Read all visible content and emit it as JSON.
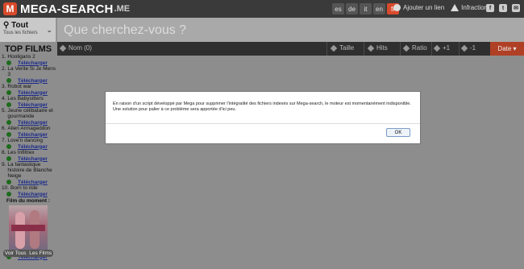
{
  "header": {
    "logo_letter": "M",
    "logo_text": "MEGA-SEARCH",
    "logo_ext": ".ME",
    "languages": [
      "es",
      "de",
      "it",
      "en",
      "fr"
    ],
    "active_language": "fr",
    "add_link_label": "Ajouter un lien",
    "infraction_label": "Infraction",
    "social": [
      "f",
      "t",
      "✉"
    ]
  },
  "search": {
    "category_label": "Tout",
    "category_sub": "Tous les fichiers",
    "placeholder": "Que cherchez-vous ?"
  },
  "columns": {
    "name": "Nom (0)",
    "size": "Taille",
    "hits": "Hits",
    "ratio": "Ratio",
    "plus": "+1",
    "minus": "-1",
    "date": "Date"
  },
  "sidebar": {
    "title": "TOP FILMS",
    "download_label": "Télécharger",
    "films": [
      {
        "num": "1.",
        "title": "Hooligans 2"
      },
      {
        "num": "2.",
        "title": "La Verite Si Je Mens 3"
      },
      {
        "num": "3.",
        "title": "Robot war"
      },
      {
        "num": "4.",
        "title": "Les Babysitters"
      },
      {
        "num": "5.",
        "title": "Jeune célibataire et gourmande"
      },
      {
        "num": "6.",
        "title": "Alien Armageddon"
      },
      {
        "num": "7.",
        "title": "Love'n dancing"
      },
      {
        "num": "8.",
        "title": "Les Infiltrex"
      },
      {
        "num": "9.",
        "title": "La fantastique histoire de Blanche Neige"
      },
      {
        "num": "10.",
        "title": "Born to ride"
      }
    ],
    "moment_title": "Film du moment :",
    "moment_download": "Télécharger",
    "button_all": "Voir Tous",
    "button_films": "Les Films"
  },
  "dialog": {
    "message": "En raison d'un script développé par Mega pour supprimer l'intégralité des fichiers indexés sur Mega-search, le moteur est momentanément indisponible. Une solution pour palier à ce problème sera apportée d'ici peu.",
    "ok_label": "OK"
  }
}
